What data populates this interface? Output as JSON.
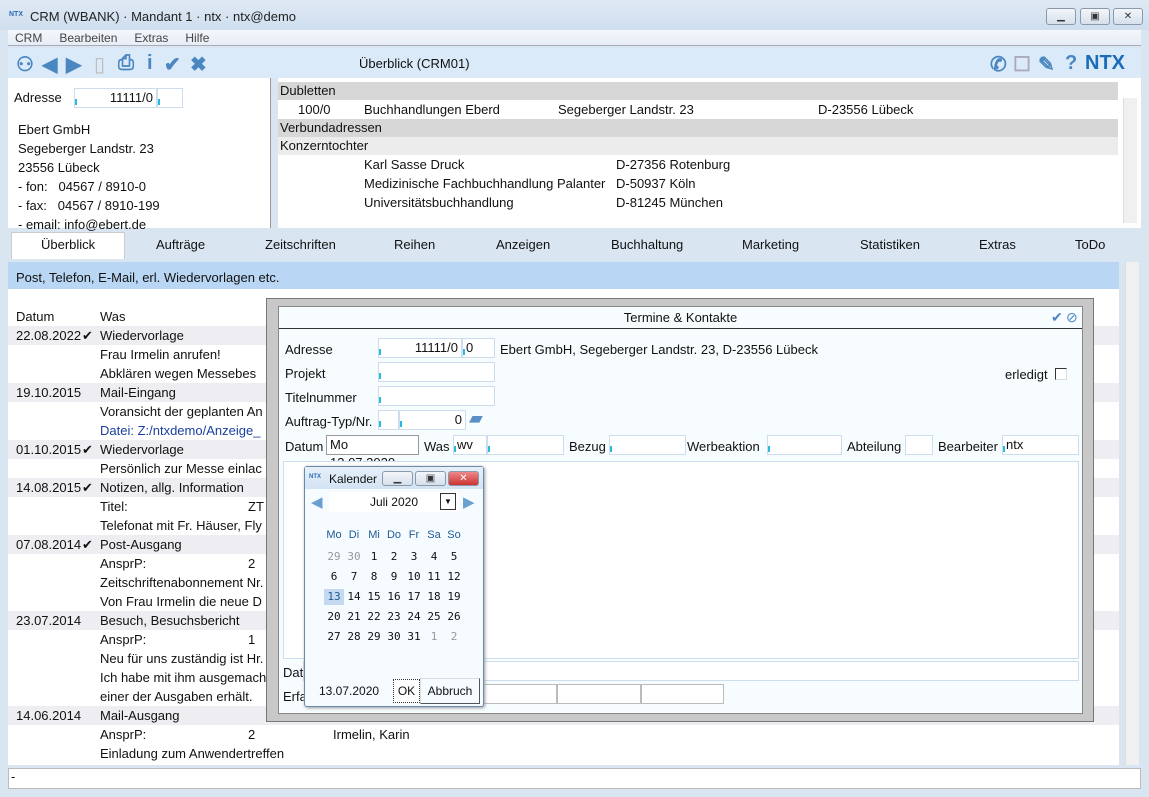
{
  "window": {
    "title": "CRM (WBANK) · Mandant 1 · ntx · ntx@demo",
    "logo": "NTX"
  },
  "menu": [
    "CRM",
    "Bearbeiten",
    "Extras",
    "Hilfe"
  ],
  "toolbar": {
    "title": "Überblick (CRM01)",
    "icons": [
      "binoculars-icon",
      "arrow-left-icon",
      "arrow-right-icon",
      "new-document-icon",
      "print-icon",
      "info-icon",
      "check-icon",
      "cancel-icon"
    ],
    "right_icons": [
      "phone-icon",
      "hand-icon",
      "pin-icon",
      "help-icon"
    ],
    "brand": "NTX"
  },
  "address": {
    "label": "Adresse",
    "value": "11111/0",
    "lines": [
      "Ebert GmbH",
      "Segeberger Landstr. 23",
      "23556 Lübeck",
      "- fon:   04567 / 8910-0",
      "- fax:   04567 / 8910-199",
      "- email: info@ebert.de"
    ]
  },
  "related": {
    "dubletten": "Dubletten",
    "dub_rows": [
      [
        "100/0",
        "Buchhandlungen Eberd",
        "Segeberger Landstr. 23",
        "D-23556 Lübeck"
      ]
    ],
    "verbund": "Verbundadressen",
    "konzern": "Konzerntochter",
    "konzern_rows": [
      [
        "Karl Sasse Druck",
        "D-27356 Rotenburg"
      ],
      [
        "Medizinische Fachbuchhandlung Palanter",
        "D-50937 Köln"
      ],
      [
        "Universitätsbuchhandlung",
        "D-81245 München"
      ]
    ]
  },
  "tabs": [
    "Überblick",
    "Aufträge",
    "Zeitschriften",
    "Reihen",
    "Anzeigen",
    "Buchhaltung",
    "Marketing",
    "Statistiken",
    "Extras",
    "ToDo"
  ],
  "strip": "Post, Telefon, E-Mail, erl. Wiedervorlagen etc.",
  "list": {
    "headers": [
      "Datum",
      "Was"
    ],
    "rows": [
      {
        "date": "22.08.2022",
        "check": "✔",
        "text": "Wiedervorlage",
        "g": true
      },
      {
        "text": "Frau Irmelin anrufen!"
      },
      {
        "text": "Abklären wegen Messebes"
      },
      {
        "date": "19.10.2015",
        "text": "Mail-Eingang",
        "g": true
      },
      {
        "text": "Voransicht der geplanten An"
      },
      {
        "text": "Datei: Z:/ntxdemo/Anzeige_",
        "link": true
      },
      {
        "date": "01.10.2015",
        "check": "✔",
        "text": "Wiedervorlage",
        "g": true
      },
      {
        "text": "Persönlich zur Messe einlac"
      },
      {
        "date": "14.08.2015",
        "check": "✔",
        "text": "Notizen, allg. Information",
        "g": true
      },
      {
        "text": "Titel:",
        "extra": "ZT"
      },
      {
        "text": "Telefonat mit Fr. Häuser, Fly"
      },
      {
        "date": "07.08.2014",
        "check": "✔",
        "text": "Post-Ausgang",
        "g": true
      },
      {
        "text": "AnsprP:",
        "extra": "2"
      },
      {
        "text": "Zeitschriftenabonnement Nr."
      },
      {
        "text": "Von Frau Irmelin die neue D"
      },
      {
        "date": "23.07.2014",
        "text": "Besuch, Besuchsbericht",
        "g": true
      },
      {
        "text": "AnsprP:",
        "extra": "1"
      },
      {
        "text": "Neu für uns zuständig ist Hr."
      },
      {
        "text": "Ich habe mit ihm ausgemach"
      },
      {
        "text": "einer der Ausgaben erhält."
      },
      {
        "date": "14.06.2014",
        "text": "Mail-Ausgang",
        "g": true
      },
      {
        "text": "AnsprP:",
        "extra": "2",
        "extra2": "Irmelin, Karin"
      },
      {
        "text": "Einladung zum Anwendertreffen"
      }
    ]
  },
  "status": "-",
  "dialog": {
    "title": "Termine & Kontakte",
    "adresse_label": "Adresse",
    "adresse_value": "11111/0",
    "adresse_sub": "0",
    "adresse_text": "Ebert GmbH, Segeberger Landstr. 23, D-23556 Lübeck",
    "projekt": "Projekt",
    "titelnummer": "Titelnummer",
    "auftrag": "Auftrag-Typ/Nr.",
    "auftrag_value": "0",
    "erledigt": "erledigt",
    "datum": "Datum",
    "datum_value": "Mo 13.07.2020",
    "was": "Was",
    "was_value": "wv",
    "bezug": "Bezug",
    "werbeaktion": "Werbeaktion",
    "abteilung": "Abteilung",
    "bearbeiter": "Bearbeiter",
    "bearbeiter_value": "ntx",
    "dat_cut": "Dat",
    "erfa_cut": "Erfa"
  },
  "calendar": {
    "title": "Kalender",
    "month": "Juli 2020",
    "weekdays": [
      "Mo",
      "Di",
      "Mi",
      "Do",
      "Fr",
      "Sa",
      "So"
    ],
    "weeks": [
      [
        "29",
        "30",
        "1",
        "2",
        "3",
        "4",
        "5"
      ],
      [
        "6",
        "7",
        "8",
        "9",
        "10",
        "11",
        "12"
      ],
      [
        "13",
        "14",
        "15",
        "16",
        "17",
        "18",
        "19"
      ],
      [
        "20",
        "21",
        "22",
        "23",
        "24",
        "25",
        "26"
      ],
      [
        "27",
        "28",
        "29",
        "30",
        "31",
        "1",
        "2"
      ]
    ],
    "selected": "13",
    "date": "13.07.2020",
    "ok": "OK",
    "cancel": "Abbruch"
  },
  "colors": {
    "accent": "#4a86c0",
    "strip": "#b9d7f4",
    "link": "#1a3fa0",
    "weekday": "#1d5a96"
  }
}
